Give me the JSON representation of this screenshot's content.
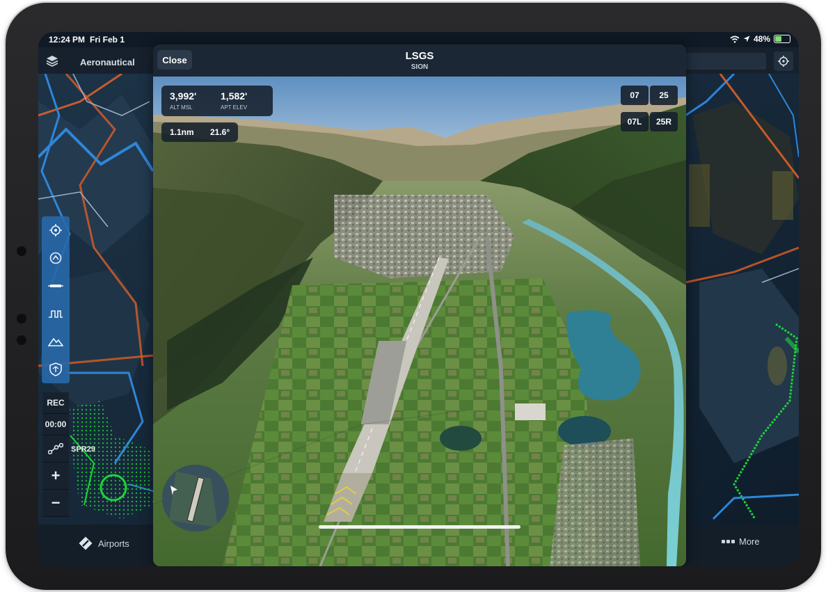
{
  "status_bar": {
    "time": "12:24 PM",
    "date": "Fri Feb 1",
    "battery": "48%"
  },
  "top_bar": {
    "layer_label": "Aeronautical"
  },
  "map_tools": [
    {
      "icon": "crosshair-icon"
    },
    {
      "icon": "route-icon"
    },
    {
      "icon": "runway-icon"
    },
    {
      "icon": "profile-icon"
    },
    {
      "icon": "terrain-icon"
    },
    {
      "icon": "shield-icon"
    }
  ],
  "track_log": {
    "rec_label": "REC",
    "timer": "00:00"
  },
  "zoom": {
    "in": "+",
    "out": "−"
  },
  "map_labels": {
    "waypoint": "SPR29"
  },
  "bottom_tabs": {
    "airports": "Airports",
    "more": "More"
  },
  "modal": {
    "close": "Close",
    "airport_id": "LSGS",
    "airport_name": "SION",
    "alt_msl": "3,992'",
    "alt_msl_label": "ALT MSL",
    "apt_elev": "1,582'",
    "apt_elev_label": "APT ELEV",
    "distance": "1.1nm",
    "angle": "21.6°",
    "runways": [
      "07",
      "25",
      "07L",
      "25R"
    ]
  }
}
